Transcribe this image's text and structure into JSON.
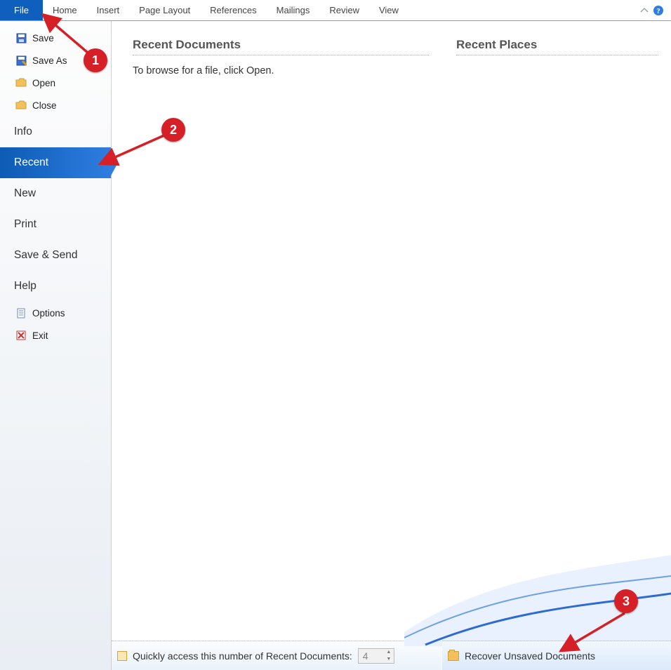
{
  "ribbon": {
    "file": "File",
    "tabs": [
      "Home",
      "Insert",
      "Page Layout",
      "References",
      "Mailings",
      "Review",
      "View"
    ]
  },
  "sidebar": {
    "save": "Save",
    "save_as": "Save As",
    "open": "Open",
    "close": "Close",
    "info": "Info",
    "recent": "Recent",
    "new": "New",
    "print": "Print",
    "save_send": "Save & Send",
    "help": "Help",
    "options": "Options",
    "exit": "Exit"
  },
  "main": {
    "recent_docs_title": "Recent Documents",
    "recent_docs_desc": "To browse for a file, click Open.",
    "recent_places_title": "Recent Places",
    "quick_access_label": "Quickly access this number of Recent Documents:",
    "quick_access_value": "4",
    "recover_label": "Recover Unsaved Documents"
  },
  "annotations": {
    "b1": "1",
    "b2": "2",
    "b3": "3"
  }
}
